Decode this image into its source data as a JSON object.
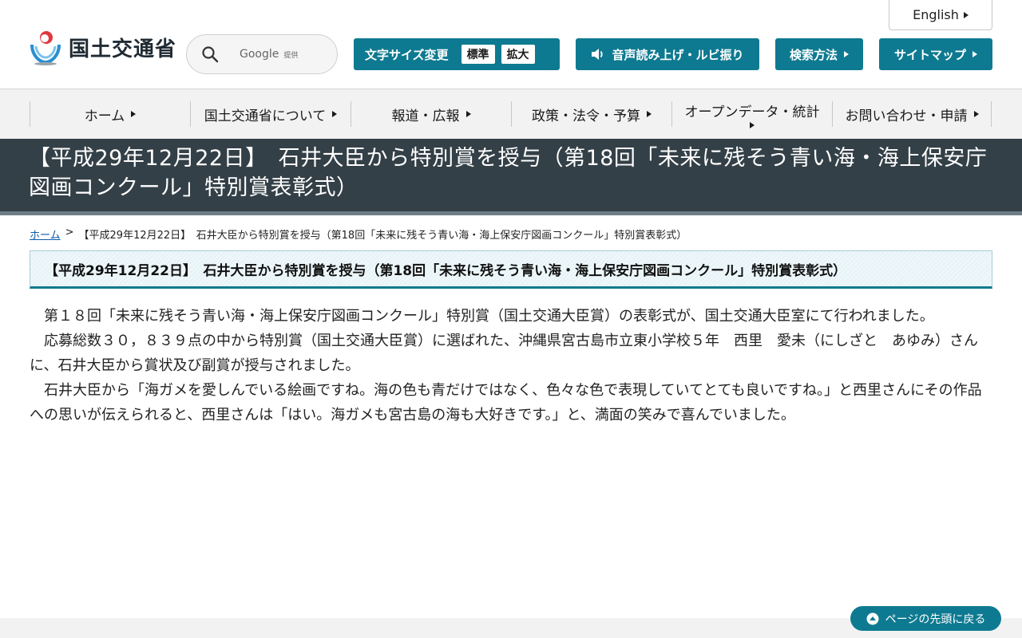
{
  "header": {
    "english_label": "English",
    "logo_text": "国土交通省",
    "search": {
      "brand": "Google",
      "sub": "提供"
    },
    "font_size": {
      "label": "文字サイズ変更",
      "standard": "標準",
      "large": "拡大"
    },
    "voice_label": "音声読み上げ・ルビ振り",
    "search_howto_label": "検索方法",
    "sitemap_label": "サイトマップ"
  },
  "nav": {
    "items": [
      {
        "label": "ホーム"
      },
      {
        "label": "国土交通省について"
      },
      {
        "label": "報道・広報"
      },
      {
        "label": "政策・法令・予算"
      },
      {
        "label": "オープンデータ・統計"
      },
      {
        "label": "お問い合わせ・申請"
      }
    ]
  },
  "page": {
    "title": "【平成29年12月22日】　石井大臣から特別賞を授与（第18回「未来に残そう青い海・海上保安庁図画コンクール」特別賞表彰式）",
    "breadcrumb": {
      "home": "ホーム",
      "separator": ">",
      "current": "【平成29年12月22日】　石井大臣から特別賞を授与（第18回「未来に残そう青い海・海上保安庁図画コンクール」特別賞表彰式）"
    },
    "heading": "【平成29年12月22日】　石井大臣から特別賞を授与（第18回「未来に残そう青い海・海上保安庁図画コンクール」特別賞表彰式）",
    "paragraphs": [
      "第１８回「未来に残そう青い海・海上保安庁図画コンクール」特別賞（国土交通大臣賞）の表彰式が、国土交通大臣室にて行われました。",
      "応募総数３０，８３９点の中から特別賞（国土交通大臣賞）に選ばれた、沖縄県宮古島市立東小学校５年　西里　愛未（にしざと　あゆみ）さんに、石井大臣から賞状及び副賞が授与されました。",
      "石井大臣から「海ガメを愛しんでいる絵画ですね。海の色も青だけではなく、色々な色で表現していてとても良いですね。」と西里さんにその作品への思いが伝えられると、西里さんは「はい。海ガメも宮古島の海も大好きです。」と、満面の笑みで喜んでいました。"
    ]
  },
  "footer": {
    "back_to_top": "ページの先頭に戻る"
  },
  "colors": {
    "accent": "#0e7a91",
    "title_band": "#344047",
    "nav_bg": "#f2f2f2"
  }
}
